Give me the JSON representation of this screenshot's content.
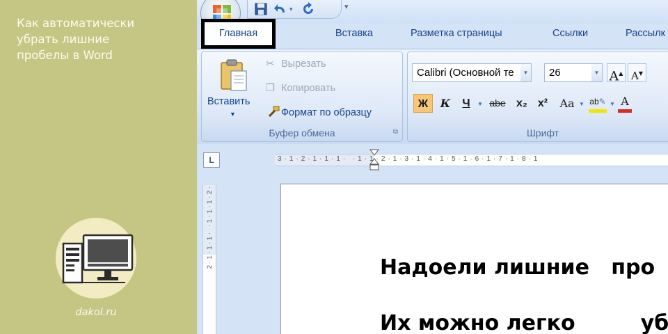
{
  "promo": {
    "title_line1": "Как автоматически",
    "title_line2": "убрать лишние",
    "title_line3": "пробелы в Word",
    "site": "dakol.ru"
  },
  "colors": {
    "promo_background": "#c6c684",
    "ribbon_text": "#15428b",
    "highlight_box": "#000000"
  },
  "quick_access": {
    "icons": [
      "save-icon",
      "undo-icon",
      "redo-icon"
    ],
    "undo_arrow": "▾",
    "customize": "▾"
  },
  "tabs": {
    "home": "Главная",
    "insert": "Вставка",
    "page_layout": "Разметка страницы",
    "references": "Ссылки",
    "mailings": "Рассылк"
  },
  "clipboard": {
    "paste": "Вставить",
    "cut": "Вырезать",
    "copy": "Копировать",
    "format_painter": "Формат по образцу",
    "group_label": "Буфер обмена"
  },
  "font": {
    "font_name": "Calibri (Основной те",
    "font_size": "26",
    "bold": "Ж",
    "italic": "К",
    "underline": "Ч",
    "strikethrough": "abe",
    "subscript": "x₂",
    "superscript": "x²",
    "change_case": "Aa",
    "grow": "A",
    "shrink": "A",
    "font_color": "A",
    "highlight": "ab",
    "group_label": "Шрифт"
  },
  "ruler": {
    "corner": "L",
    "marks": "3 · 1 · 2 · 1 · 1 · 1 ·   · 1 · 1 · 2 · 1 · 3 · 1 · 4 · 1 · 5 · 1 · 6 · 1 · 7 · 1 · 8 · 1",
    "vmarks": "2 · 1 · 1 · 1 ·   · 1 · 1 · 1 · 2 ·"
  },
  "document": {
    "line1": "Надоели лишние   про",
    "line2": "Их можно легко         уб"
  }
}
